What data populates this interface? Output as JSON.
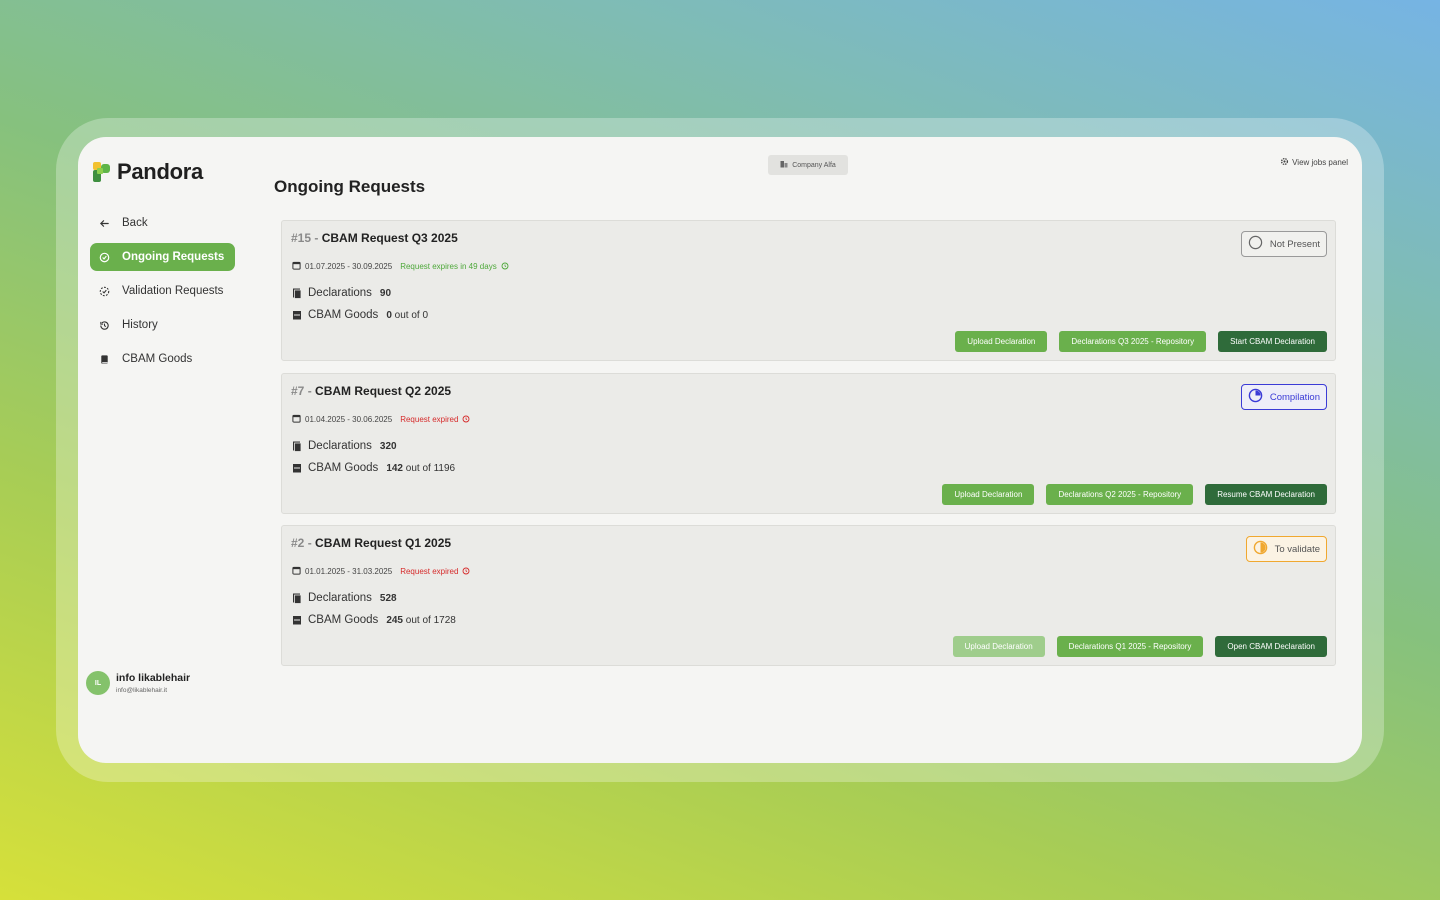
{
  "app": {
    "name": "Pandora"
  },
  "sidebar": {
    "items": [
      {
        "label": "Back",
        "icon": "arrow-left-icon",
        "active": false
      },
      {
        "label": "Ongoing Requests",
        "icon": "target-icon",
        "active": true
      },
      {
        "label": "Validation Requests",
        "icon": "dashed-check-icon",
        "active": false
      },
      {
        "label": "History",
        "icon": "history-icon",
        "active": false
      },
      {
        "label": "CBAM Goods",
        "icon": "book-icon",
        "active": false
      }
    ]
  },
  "user": {
    "initials": "IL",
    "name": "info likablehair",
    "email": "info@likablehair.it"
  },
  "topbar": {
    "company": "Company Alfa",
    "jobs": "View jobs panel"
  },
  "page": {
    "title": "Ongoing Requests"
  },
  "colors": {
    "accent": "#6ab04c",
    "dark_green": "#2f6b3a",
    "expired": "#d62b2b",
    "compilation": "#3b3bd6",
    "to_validate": "#f0a830"
  },
  "requests": [
    {
      "num": "#15",
      "sep": " - ",
      "title": "CBAM Request Q3 2025",
      "dates": "01.07.2025 - 30.09.2025",
      "expiry": "Request expires in 49 days",
      "expired": false,
      "declarations_label": "Declarations",
      "declarations": "90",
      "goods_label": "CBAM Goods",
      "goods_done": "0",
      "goods_of": "out of",
      "goods_total": "0",
      "status": "Not Present",
      "status_kind": "gray",
      "buttons": [
        "Upload Declaration",
        "Declarations Q3 2025 - Repository",
        "Start CBAM Declaration"
      ]
    },
    {
      "num": "#7",
      "sep": " - ",
      "title": "CBAM Request Q2 2025",
      "dates": "01.04.2025 - 30.06.2025",
      "expiry": "Request expired",
      "expired": true,
      "declarations_label": "Declarations",
      "declarations": "320",
      "goods_label": "CBAM Goods",
      "goods_done": "142",
      "goods_of": "out of",
      "goods_total": "1196",
      "status": "Compilation",
      "status_kind": "blue",
      "buttons": [
        "Upload Declaration",
        "Declarations Q2 2025 - Repository",
        "Resume CBAM Declaration"
      ]
    },
    {
      "num": "#2",
      "sep": " - ",
      "title": "CBAM Request Q1 2025",
      "dates": "01.01.2025 - 31.03.2025",
      "expiry": "Request expired",
      "expired": true,
      "declarations_label": "Declarations",
      "declarations": "528",
      "goods_label": "CBAM Goods",
      "goods_done": "245",
      "goods_of": "out of",
      "goods_total": "1728",
      "status": "To validate",
      "status_kind": "orange",
      "buttons": [
        "Upload Declaration",
        "Declarations Q1 2025 - Repository",
        "Open CBAM Declaration"
      ]
    }
  ]
}
